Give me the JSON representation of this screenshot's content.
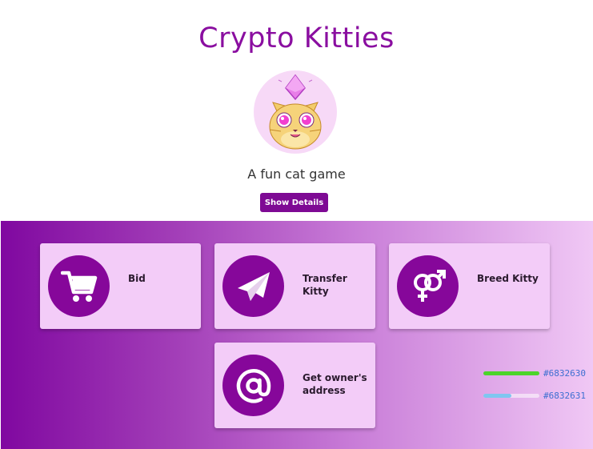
{
  "header": {
    "title": "Crypto Kitties",
    "subtitle": "A fun cat game",
    "details_button": "Show Details"
  },
  "actions": [
    {
      "label": "Bid",
      "icon": "cart-icon"
    },
    {
      "label": "Transfer Kitty",
      "icon": "paper-plane-icon"
    },
    {
      "label": "Breed Kitty",
      "icon": "gender-icon"
    },
    {
      "label": "Get owner's address",
      "icon": "at-icon"
    }
  ],
  "legend": [
    {
      "text": "#6832630",
      "color": "#4cd42a",
      "fill": 1.0
    },
    {
      "text": "#6832631",
      "color": "#7fc6f0",
      "fill": 0.5
    }
  ],
  "colors": {
    "accent": "#86079a",
    "card": "#f3ccf8",
    "title": "#8a0ea0"
  }
}
